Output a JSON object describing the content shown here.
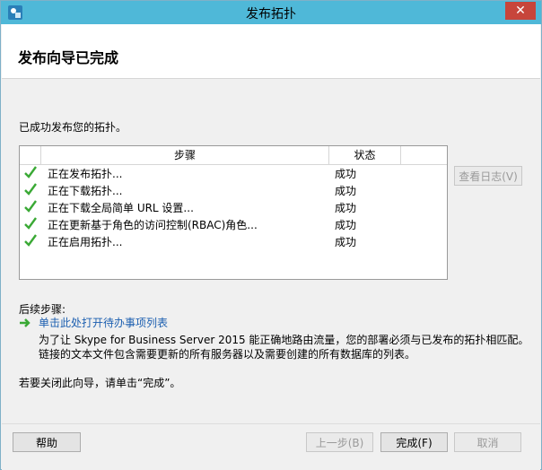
{
  "window": {
    "title": "发布拓扑",
    "close_glyph": "✕"
  },
  "header": {
    "heading": "发布向导已完成"
  },
  "main": {
    "message": "已成功发布您的拓扑。",
    "table": {
      "columns": [
        "步骤",
        "状态"
      ],
      "rows": [
        {
          "step": "正在发布拓扑...",
          "status": "成功"
        },
        {
          "step": "正在下载拓扑...",
          "status": "成功"
        },
        {
          "step": "正在下载全局简单 URL 设置...",
          "status": "成功"
        },
        {
          "step": "正在更新基于角色的访问控制(RBAC)角色...",
          "status": "成功"
        },
        {
          "step": "正在启用拓扑...",
          "status": "成功"
        }
      ]
    },
    "view_log_label": "查看日志(V)",
    "next_steps_title": "后续步骤:",
    "todo_link": "单击此处打开待办事项列表",
    "description_line1": "为了让 Skype for Business Server 2015 能正确地路由流量，您的部署必须与已发布的拓扑相匹配。",
    "description_line2": "链接的文本文件包含需要更新的所有服务器以及需要创建的所有数据库的列表。",
    "close_hint": "若要关闭此向导，请单击“完成”。"
  },
  "footer": {
    "help_label": "帮助",
    "back_label": "上一步(B)",
    "finish_label": "完成(F)",
    "cancel_label": "取消"
  },
  "colors": {
    "titlebar": "#4fb8d8",
    "close": "#c7453b",
    "check": "#3aa935",
    "link": "#1c5fb0"
  }
}
